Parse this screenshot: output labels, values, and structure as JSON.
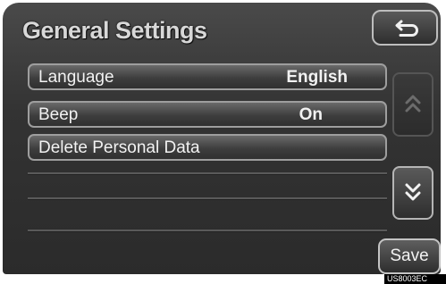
{
  "header": {
    "title": "General Settings",
    "back_icon": "return-arrow-icon"
  },
  "settings": [
    {
      "label": "Language",
      "value": "English"
    },
    {
      "label": "Beep",
      "value": "On"
    },
    {
      "label": "Delete Personal Data",
      "value": ""
    }
  ],
  "scroll": {
    "up_icon": "double-chevron-up-icon",
    "down_icon": "double-chevron-down-icon"
  },
  "footer": {
    "save_label": "Save"
  },
  "image_code": "US8003EC"
}
